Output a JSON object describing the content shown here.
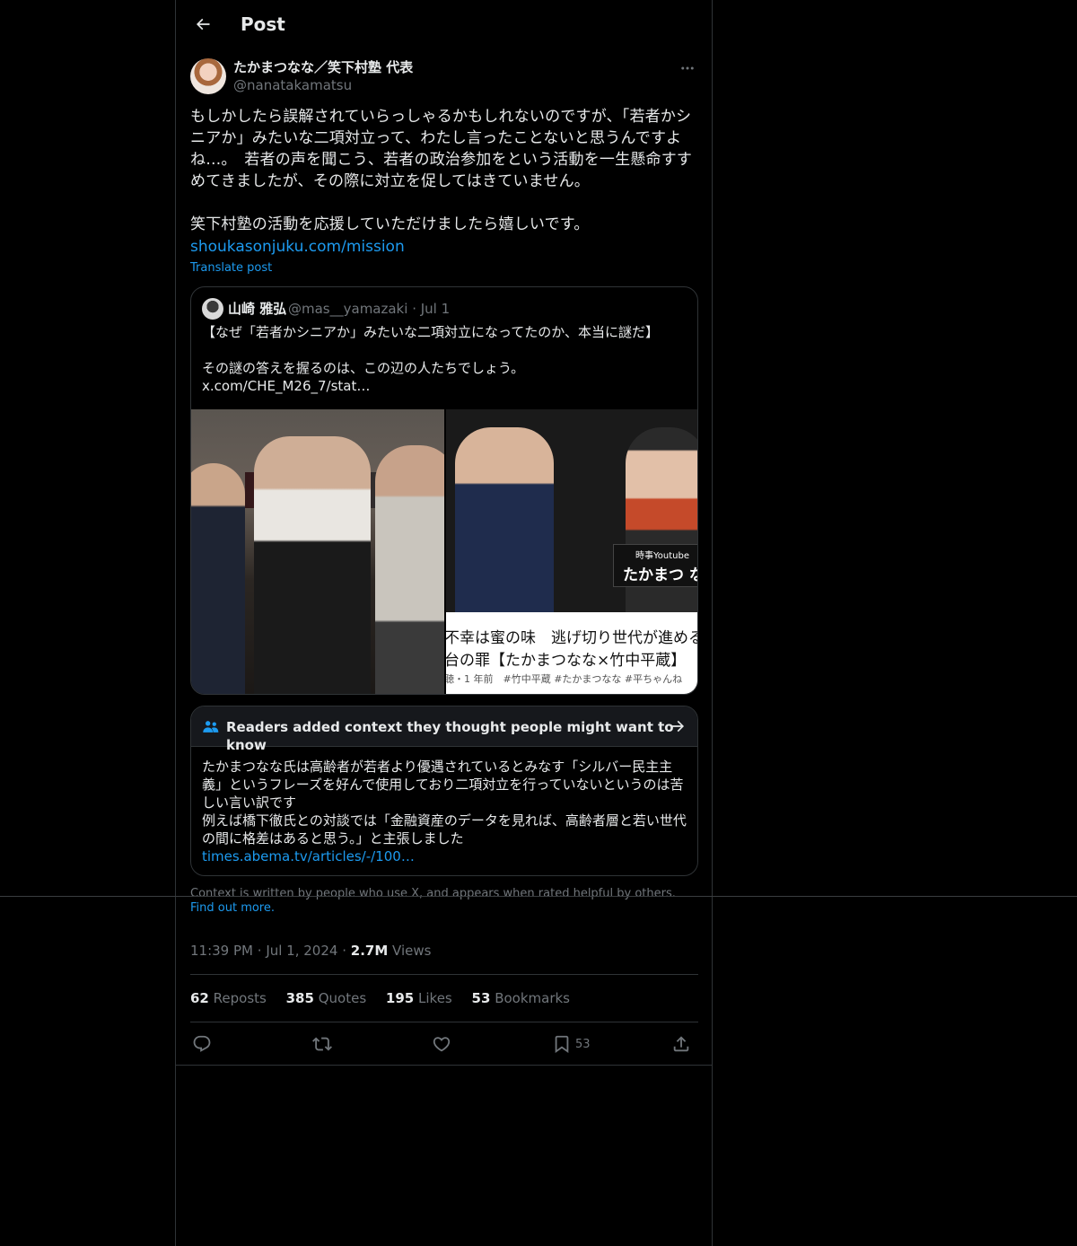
{
  "header": {
    "title": "Post"
  },
  "author": {
    "display_name": "たかまつなな／笑下村塾 代表",
    "handle": "@nanatakamatsu"
  },
  "post": {
    "text": "もしかしたら誤解されていらっしゃるかもしれないのですが、「若者かシニアか」みたいな二項対立って、わたし言ったことないと思うんですよね…。　若者の声を聞こう、若者の政治参加をという活動を一生懸命すすめてきましたが、その際に対立を促してはきていません。\n\n笑下村塾の活動を応援していただけましたら嬉しいです。",
    "link": "shoukasonjuku.com/mission",
    "translate_label": "Translate post"
  },
  "quote": {
    "name": "山崎 雅弘",
    "handle": "@mas__yamazaki",
    "date": "Jul 1",
    "text": "【なぜ「若者かシニアか」みたいな二項対立になってたのか、本当に謎だ】\n\nその謎の答えを握るのは、この辺の人たちでしょう。\nx.com/CHE_M26_7/stat…",
    "media_right": {
      "overlay_small": "時事Youtube",
      "overlay_name": "たかまつ な",
      "caption_line1": "不幸は蜜の味　逃げ切り世代が進める",
      "caption_line2": "台の罪【たかまつなな×竹中平蔵】",
      "caption_line3": "聴・1 年前　#竹中平蔵 #たかまつなな #平ちゃんね"
    }
  },
  "context": {
    "title": "Readers added context they thought people might want to know",
    "body": "たかまつなな氏は高齢者が若者より優遇されているとみなす「シルバー民主主義」というフレーズを好んで使用しており二項対立を行っていないというのは苦しい言い訳です\n例えば橋下徹氏との対談では「金融資産のデータを見れば、高齢者層と若い世代の間に格差はあると思う。」と主張しました",
    "link": "times.abema.tv/articles/-/100…",
    "footer_text": "Context is written by people who use X, and appears when rated helpful by others.",
    "footer_link": "Find out more."
  },
  "meta": {
    "time": "11:39 PM",
    "date": "Jul 1, 2024",
    "views_count": "2.7M",
    "views_label": "Views"
  },
  "stats": {
    "reposts_count": "62",
    "reposts_label": "Reposts",
    "quotes_count": "385",
    "quotes_label": "Quotes",
    "likes_count": "195",
    "likes_label": "Likes",
    "bookmarks_count": "53",
    "bookmarks_label": "Bookmarks"
  },
  "actions": {
    "bookmark_count": "53"
  },
  "icons": {
    "back": "arrow-left-icon",
    "more": "more-horizontal-icon",
    "context": "community-icon",
    "context_arrow": "arrow-right-icon",
    "reply": "reply-icon",
    "repost": "repost-icon",
    "like": "heart-icon",
    "bookmark": "bookmark-icon",
    "share": "share-icon"
  },
  "colors": {
    "background": "#000000",
    "text": "#e7e9ea",
    "secondary": "#71767b",
    "accent": "#1d9bf0",
    "border": "#2f3336"
  }
}
